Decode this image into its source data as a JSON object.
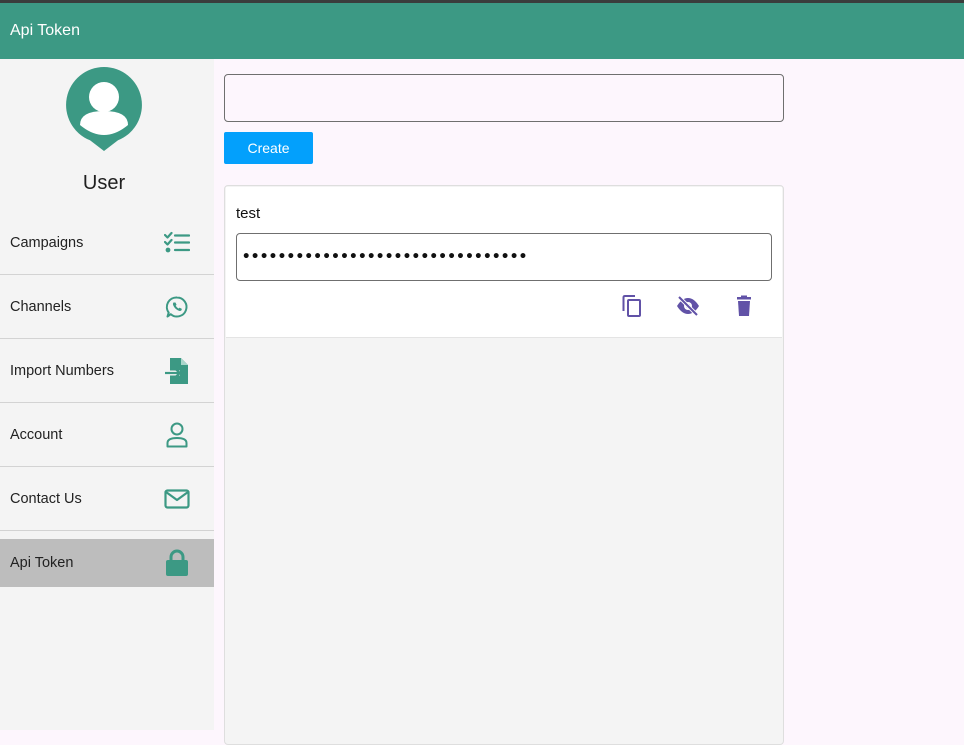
{
  "app": {
    "title": "Api Token"
  },
  "sidebar": {
    "user_name": "User",
    "items": [
      {
        "label": "Campaigns",
        "icon": "checklist-icon",
        "active": false
      },
      {
        "label": "Channels",
        "icon": "whatsapp-icon",
        "active": false
      },
      {
        "label": "Import Numbers",
        "icon": "file-import-icon",
        "active": false
      },
      {
        "label": "Account",
        "icon": "person-outline-icon",
        "active": false
      },
      {
        "label": "Contact Us",
        "icon": "mail-icon",
        "active": false
      },
      {
        "label": "Api Token",
        "icon": "lock-icon",
        "active": true
      }
    ]
  },
  "main": {
    "token_input": {
      "value": "",
      "placeholder": ""
    },
    "create_label": "Create",
    "tokens": [
      {
        "name": "test",
        "masked_value": "••••••••••••••••••••••••••••••••"
      }
    ]
  },
  "colors": {
    "primary": "#3c9984",
    "accent": "#03a0fc",
    "action_icon": "#6152a7",
    "active_bg": "#bdbdbd"
  }
}
